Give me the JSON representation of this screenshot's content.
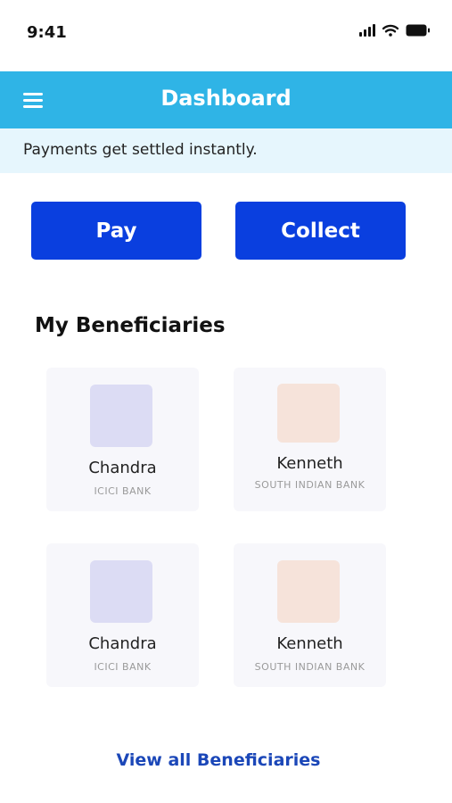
{
  "status_bar": {
    "time": "9:41"
  },
  "header": {
    "title": "Dashboard",
    "menu_icon": "hamburger-menu-icon"
  },
  "banner": {
    "text": "Payments get settled instantly."
  },
  "actions": {
    "pay_label": "Pay",
    "collect_label": "Collect"
  },
  "beneficiaries": {
    "title": "My Beneficiaries",
    "items": [
      {
        "name": "Chandra",
        "bank": "ICICI BANK",
        "avatar_color": "#dcdcf4"
      },
      {
        "name": "Kenneth",
        "bank": "SOUTH INDIAN BANK",
        "avatar_color": "#f6e3da"
      },
      {
        "name": "Chandra",
        "bank": "ICICI BANK",
        "avatar_color": "#dcdcf4"
      },
      {
        "name": "Kenneth",
        "bank": "SOUTH INDIAN BANK",
        "avatar_color": "#f6e3da"
      }
    ],
    "view_all_label": "View all Beneficiaries"
  },
  "colors": {
    "app_bar": "#2fb4e6",
    "banner_bg": "#e6f6fd",
    "primary_button": "#0a3fdf",
    "link": "#1b47b8"
  }
}
